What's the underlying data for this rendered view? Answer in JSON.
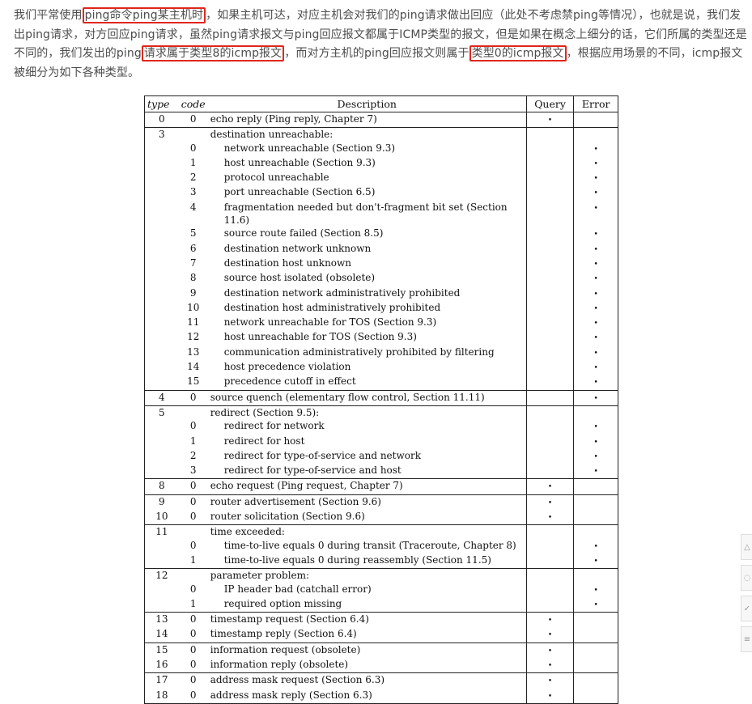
{
  "paragraph": {
    "parts": [
      {
        "text": "我们平常使用",
        "hl": false
      },
      {
        "text": "ping命令ping某主机时",
        "hl": true
      },
      {
        "text": "，如果主机可达，对应主机会对我们的ping请求做出回应（此处不考虑禁ping等情况），也就是说，我们发出ping请求，对方回应ping请求，虽然ping请求报文与ping回应报文都属于ICMP类型的报文，但是如果在概念上细分的话，它们所属的类型还是不同的，我们发出的ping",
        "hl": false
      },
      {
        "text": "请求属于类型8的icmp报文",
        "hl": true
      },
      {
        "text": "，而对方主机的ping回应报文则属于",
        "hl": false
      },
      {
        "text": "类型0的icmp报文",
        "hl": true
      },
      {
        "text": "，根据应用场景的不同，icmp报文被细分为如下各种类型。",
        "hl": false
      }
    ]
  },
  "table": {
    "headers": {
      "type": "type",
      "code": "code",
      "desc": "Description",
      "query": "Query",
      "error": "Error"
    },
    "rows": [
      {
        "type": "0",
        "code": "0",
        "desc": "echo reply (Ping reply, Chapter 7)",
        "q": true,
        "e": false,
        "end": true
      },
      {
        "type": "3",
        "code": "",
        "desc": "destination unreachable:",
        "q": false,
        "e": false
      },
      {
        "type": "",
        "code": "0",
        "desc": "network unreachable (Section 9.3)",
        "q": false,
        "e": true,
        "indent": true
      },
      {
        "type": "",
        "code": "1",
        "desc": "host unreachable (Section 9.3)",
        "q": false,
        "e": true,
        "indent": true
      },
      {
        "type": "",
        "code": "2",
        "desc": "protocol unreachable",
        "q": false,
        "e": true,
        "indent": true
      },
      {
        "type": "",
        "code": "3",
        "desc": "port unreachable (Section 6.5)",
        "q": false,
        "e": true,
        "indent": true
      },
      {
        "type": "",
        "code": "4",
        "desc": "fragmentation needed but don't-fragment bit set (Section 11.6)",
        "q": false,
        "e": true,
        "indent": true
      },
      {
        "type": "",
        "code": "5",
        "desc": "source route failed (Section 8.5)",
        "q": false,
        "e": true,
        "indent": true
      },
      {
        "type": "",
        "code": "6",
        "desc": "destination network unknown",
        "q": false,
        "e": true,
        "indent": true
      },
      {
        "type": "",
        "code": "7",
        "desc": "destination host unknown",
        "q": false,
        "e": true,
        "indent": true
      },
      {
        "type": "",
        "code": "8",
        "desc": "source host isolated (obsolete)",
        "q": false,
        "e": true,
        "indent": true
      },
      {
        "type": "",
        "code": "9",
        "desc": "destination network administratively prohibited",
        "q": false,
        "e": true,
        "indent": true
      },
      {
        "type": "",
        "code": "10",
        "desc": "destination host administratively prohibited",
        "q": false,
        "e": true,
        "indent": true
      },
      {
        "type": "",
        "code": "11",
        "desc": "network unreachable for TOS (Section 9.3)",
        "q": false,
        "e": true,
        "indent": true
      },
      {
        "type": "",
        "code": "12",
        "desc": "host unreachable for TOS (Section 9.3)",
        "q": false,
        "e": true,
        "indent": true
      },
      {
        "type": "",
        "code": "13",
        "desc": "communication administratively prohibited by filtering",
        "q": false,
        "e": true,
        "indent": true
      },
      {
        "type": "",
        "code": "14",
        "desc": "host precedence violation",
        "q": false,
        "e": true,
        "indent": true
      },
      {
        "type": "",
        "code": "15",
        "desc": "precedence cutoff in effect",
        "q": false,
        "e": true,
        "indent": true,
        "end": true
      },
      {
        "type": "4",
        "code": "0",
        "desc": "source quench (elementary flow control, Section 11.11)",
        "q": false,
        "e": true,
        "end": true
      },
      {
        "type": "5",
        "code": "",
        "desc": "redirect (Section 9.5):",
        "q": false,
        "e": false
      },
      {
        "type": "",
        "code": "0",
        "desc": "redirect for network",
        "q": false,
        "e": true,
        "indent": true
      },
      {
        "type": "",
        "code": "1",
        "desc": "redirect for host",
        "q": false,
        "e": true,
        "indent": true
      },
      {
        "type": "",
        "code": "2",
        "desc": "redirect for type-of-service and network",
        "q": false,
        "e": true,
        "indent": true
      },
      {
        "type": "",
        "code": "3",
        "desc": "redirect for type-of-service and host",
        "q": false,
        "e": true,
        "indent": true,
        "end": true
      },
      {
        "type": "8",
        "code": "0",
        "desc": "echo request (Ping request, Chapter 7)",
        "q": true,
        "e": false,
        "end": true
      },
      {
        "type": "9",
        "code": "0",
        "desc": "router advertisement (Section 9.6)",
        "q": true,
        "e": false
      },
      {
        "type": "10",
        "code": "0",
        "desc": "router solicitation (Section 9.6)",
        "q": true,
        "e": false,
        "end": true
      },
      {
        "type": "11",
        "code": "",
        "desc": "time exceeded:",
        "q": false,
        "e": false
      },
      {
        "type": "",
        "code": "0",
        "desc": "time-to-live equals 0 during transit (Traceroute, Chapter 8)",
        "q": false,
        "e": true,
        "indent": true
      },
      {
        "type": "",
        "code": "1",
        "desc": "time-to-live equals 0 during reassembly (Section 11.5)",
        "q": false,
        "e": true,
        "indent": true,
        "end": true
      },
      {
        "type": "12",
        "code": "",
        "desc": "parameter problem:",
        "q": false,
        "e": false
      },
      {
        "type": "",
        "code": "0",
        "desc": "IP header bad (catchall error)",
        "q": false,
        "e": true,
        "indent": true
      },
      {
        "type": "",
        "code": "1",
        "desc": "required option missing",
        "q": false,
        "e": true,
        "indent": true,
        "end": true
      },
      {
        "type": "13",
        "code": "0",
        "desc": "timestamp request (Section 6.4)",
        "q": true,
        "e": false
      },
      {
        "type": "14",
        "code": "0",
        "desc": "timestamp reply (Section 6.4)",
        "q": true,
        "e": false,
        "end": true
      },
      {
        "type": "15",
        "code": "0",
        "desc": "information request (obsolete)",
        "q": true,
        "e": false
      },
      {
        "type": "16",
        "code": "0",
        "desc": "information reply (obsolete)",
        "q": true,
        "e": false,
        "end": true
      },
      {
        "type": "17",
        "code": "0",
        "desc": "address mask request (Section 6.3)",
        "q": true,
        "e": false
      },
      {
        "type": "18",
        "code": "0",
        "desc": "address mask reply (Section 6.3)",
        "q": true,
        "e": false
      }
    ]
  },
  "bullet": "•",
  "highlight_color": "#e0261c"
}
